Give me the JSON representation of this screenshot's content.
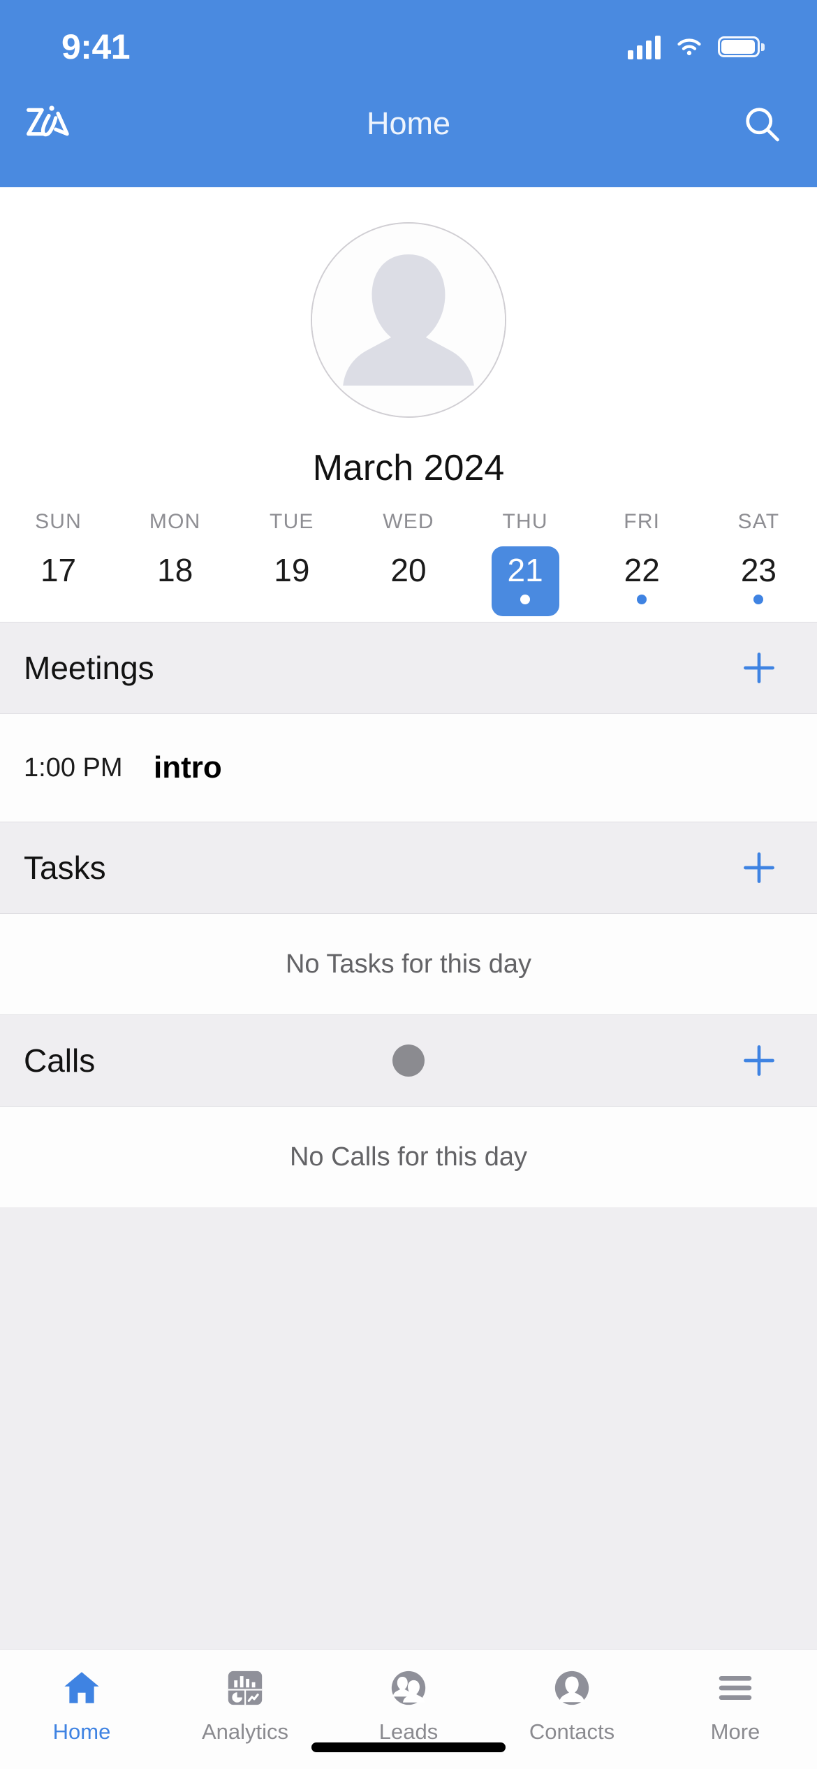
{
  "status_bar": {
    "time": "9:41",
    "signal_icon": "cellular-signal-icon",
    "wifi_icon": "wifi-icon",
    "battery_icon": "battery-icon"
  },
  "header": {
    "title": "Home",
    "logo_icon": "zia-logo-icon",
    "search_icon": "search-icon",
    "background_color": "#4a8ae0"
  },
  "profile": {
    "avatar_icon": "default-user-avatar-icon"
  },
  "calendar": {
    "month_label": "March 2024",
    "weekdays": [
      "SUN",
      "MON",
      "TUE",
      "WED",
      "THU",
      "FRI",
      "SAT"
    ],
    "days": [
      {
        "number": "17",
        "selected": false,
        "has_event": false
      },
      {
        "number": "18",
        "selected": false,
        "has_event": false
      },
      {
        "number": "19",
        "selected": false,
        "has_event": false
      },
      {
        "number": "20",
        "selected": false,
        "has_event": false
      },
      {
        "number": "21",
        "selected": true,
        "has_event": true
      },
      {
        "number": "22",
        "selected": false,
        "has_event": true
      },
      {
        "number": "23",
        "selected": false,
        "has_event": true
      }
    ],
    "selected_color": "#4a8ae0",
    "event_dot_color": "#3f83e2"
  },
  "sections": {
    "meetings": {
      "title": "Meetings",
      "add_icon": "plus-icon",
      "items": [
        {
          "time": "1:00 PM",
          "title": "intro"
        }
      ]
    },
    "tasks": {
      "title": "Tasks",
      "add_icon": "plus-icon",
      "empty_text": "No Tasks for this day"
    },
    "calls": {
      "title": "Calls",
      "add_icon": "plus-icon",
      "empty_text": "No Calls for this day",
      "touch_indicator_color": "#8b8b90"
    }
  },
  "tab_bar": {
    "active_color": "#3f83e2",
    "inactive_color": "#8a8a8f",
    "tabs": [
      {
        "label": "Home",
        "icon": "home-icon",
        "active": true
      },
      {
        "label": "Analytics",
        "icon": "analytics-icon",
        "active": false
      },
      {
        "label": "Leads",
        "icon": "leads-icon",
        "active": false
      },
      {
        "label": "Contacts",
        "icon": "contacts-icon",
        "active": false
      },
      {
        "label": "More",
        "icon": "hamburger-menu-icon",
        "active": false
      }
    ]
  }
}
